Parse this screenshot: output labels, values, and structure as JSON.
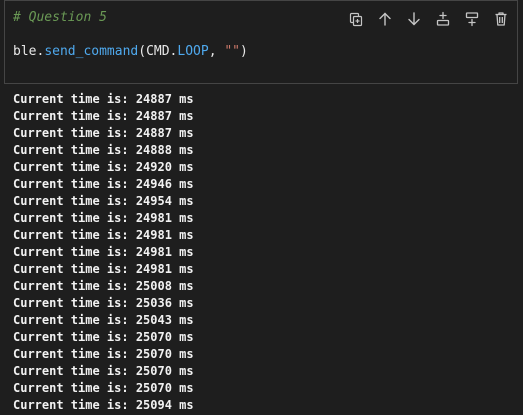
{
  "cell": {
    "comment": "# Question 5",
    "code": {
      "object": "ble",
      "dot1": ".",
      "method": "send_command",
      "open_paren": "(",
      "arg_object": "CMD",
      "dot2": ".",
      "arg_member": "LOOP",
      "comma": ", ",
      "arg_string": "\"\"",
      "close_paren": ")"
    },
    "toolbar": [
      {
        "name": "split-cell-icon",
        "title": "Split cell"
      },
      {
        "name": "move-up-icon",
        "title": "Move up"
      },
      {
        "name": "move-down-icon",
        "title": "Move down"
      },
      {
        "name": "insert-above-icon",
        "title": "Insert above"
      },
      {
        "name": "insert-below-icon",
        "title": "Insert below"
      },
      {
        "name": "delete-icon",
        "title": "Delete"
      }
    ]
  },
  "output": {
    "lines": [
      "Current time is: 24887 ms",
      "Current time is: 24887 ms",
      "Current time is: 24887 ms",
      "Current time is: 24888 ms",
      "Current time is: 24920 ms",
      "Current time is: 24946 ms",
      "Current time is: 24954 ms",
      "Current time is: 24981 ms",
      "Current time is: 24981 ms",
      "Current time is: 24981 ms",
      "Current time is: 24981 ms",
      "Current time is: 25008 ms",
      "Current time is: 25036 ms",
      "Current time is: 25043 ms",
      "Current time is: 25070 ms",
      "Current time is: 25070 ms",
      "Current time is: 25070 ms",
      "Current time is: 25070 ms",
      "Current time is: 25094 ms"
    ]
  }
}
